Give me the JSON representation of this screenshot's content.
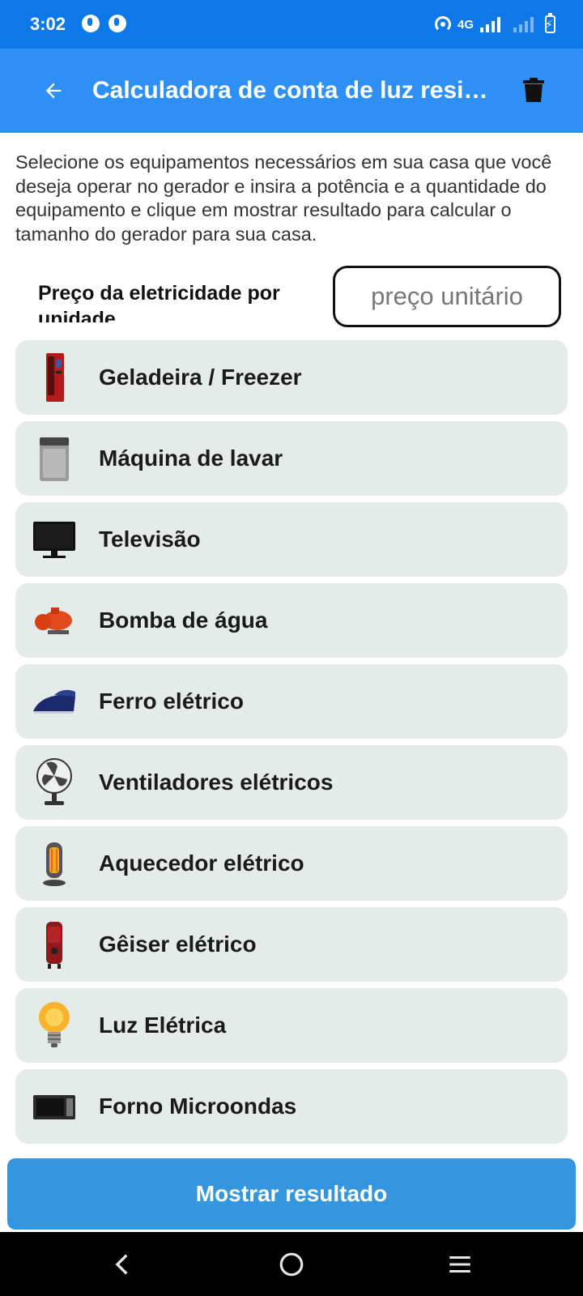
{
  "status_bar": {
    "time": "3:02",
    "network": "4G"
  },
  "app_bar": {
    "title": "Calculadora de conta de luz residencial",
    "back_icon": "arrow-left-icon",
    "delete_icon": "trash-icon"
  },
  "description": "Selecione os equipamentos necessários em sua casa que você deseja operar no gerador e insira a potência e a quantidade do equipamento e clique em mostrar resultado para calcular o tamanho do gerador para sua casa.",
  "price": {
    "label": "Preço da eletricidade por unidade",
    "placeholder": "preço unitário",
    "value": ""
  },
  "equipment": [
    {
      "label": "Geladeira / Freezer",
      "icon": "refrigerator-icon"
    },
    {
      "label": "Máquina de lavar",
      "icon": "washing-machine-icon"
    },
    {
      "label": "Televisão",
      "icon": "television-icon"
    },
    {
      "label": "Bomba de água",
      "icon": "water-pump-icon"
    },
    {
      "label": "Ferro elétrico",
      "icon": "iron-icon"
    },
    {
      "label": "Ventiladores elétricos",
      "icon": "fan-icon"
    },
    {
      "label": "Aquecedor elétrico",
      "icon": "heater-icon"
    },
    {
      "label": "Gêiser elétrico",
      "icon": "geyser-icon"
    },
    {
      "label": "Luz Elétrica",
      "icon": "light-bulb-icon"
    },
    {
      "label": "Forno Microondas",
      "icon": "microwave-icon"
    }
  ],
  "actions": {
    "show_result_label": "Mostrar resultado"
  },
  "colors": {
    "status_bar": "#0f78e8",
    "app_bar": "#2e90f5",
    "list_item_bg": "#e4ebe8",
    "button": "#3396de"
  }
}
